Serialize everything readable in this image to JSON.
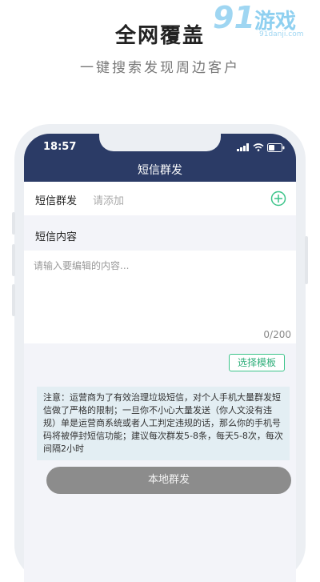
{
  "promo": {
    "headline": "全网覆盖",
    "subline": "一键搜索发现周边客户"
  },
  "watermark": {
    "logo": "91",
    "brand": "游戏",
    "url": "91danji.com"
  },
  "status_bar": {
    "time": "18:57",
    "icons": [
      "signal-icon",
      "wifi-icon",
      "battery-icon"
    ]
  },
  "nav": {
    "title": "短信群发"
  },
  "recipient": {
    "label": "短信群发",
    "placeholder": "请添加",
    "add_icon": "plus-circle-icon"
  },
  "message": {
    "label": "短信内容",
    "placeholder": "请输入要编辑的内容...",
    "counter": "0/200"
  },
  "template_button": "选择模板",
  "notice": "注意：运营商为了有效治理垃圾短信，对个人手机大量群发短信做了严格的限制；一旦你不小心大量发送（你人文没有违规）单是运营商系统或者人工判定违规的话，那么你的手机号码将被停封短信功能；建议每次群发5-8条，每天5-8次，每次间隔2小时",
  "send_button": "本地群发",
  "colors": {
    "header": "#2b3b66",
    "accent": "#3cc48a",
    "send_button": "#8c8c8c"
  }
}
